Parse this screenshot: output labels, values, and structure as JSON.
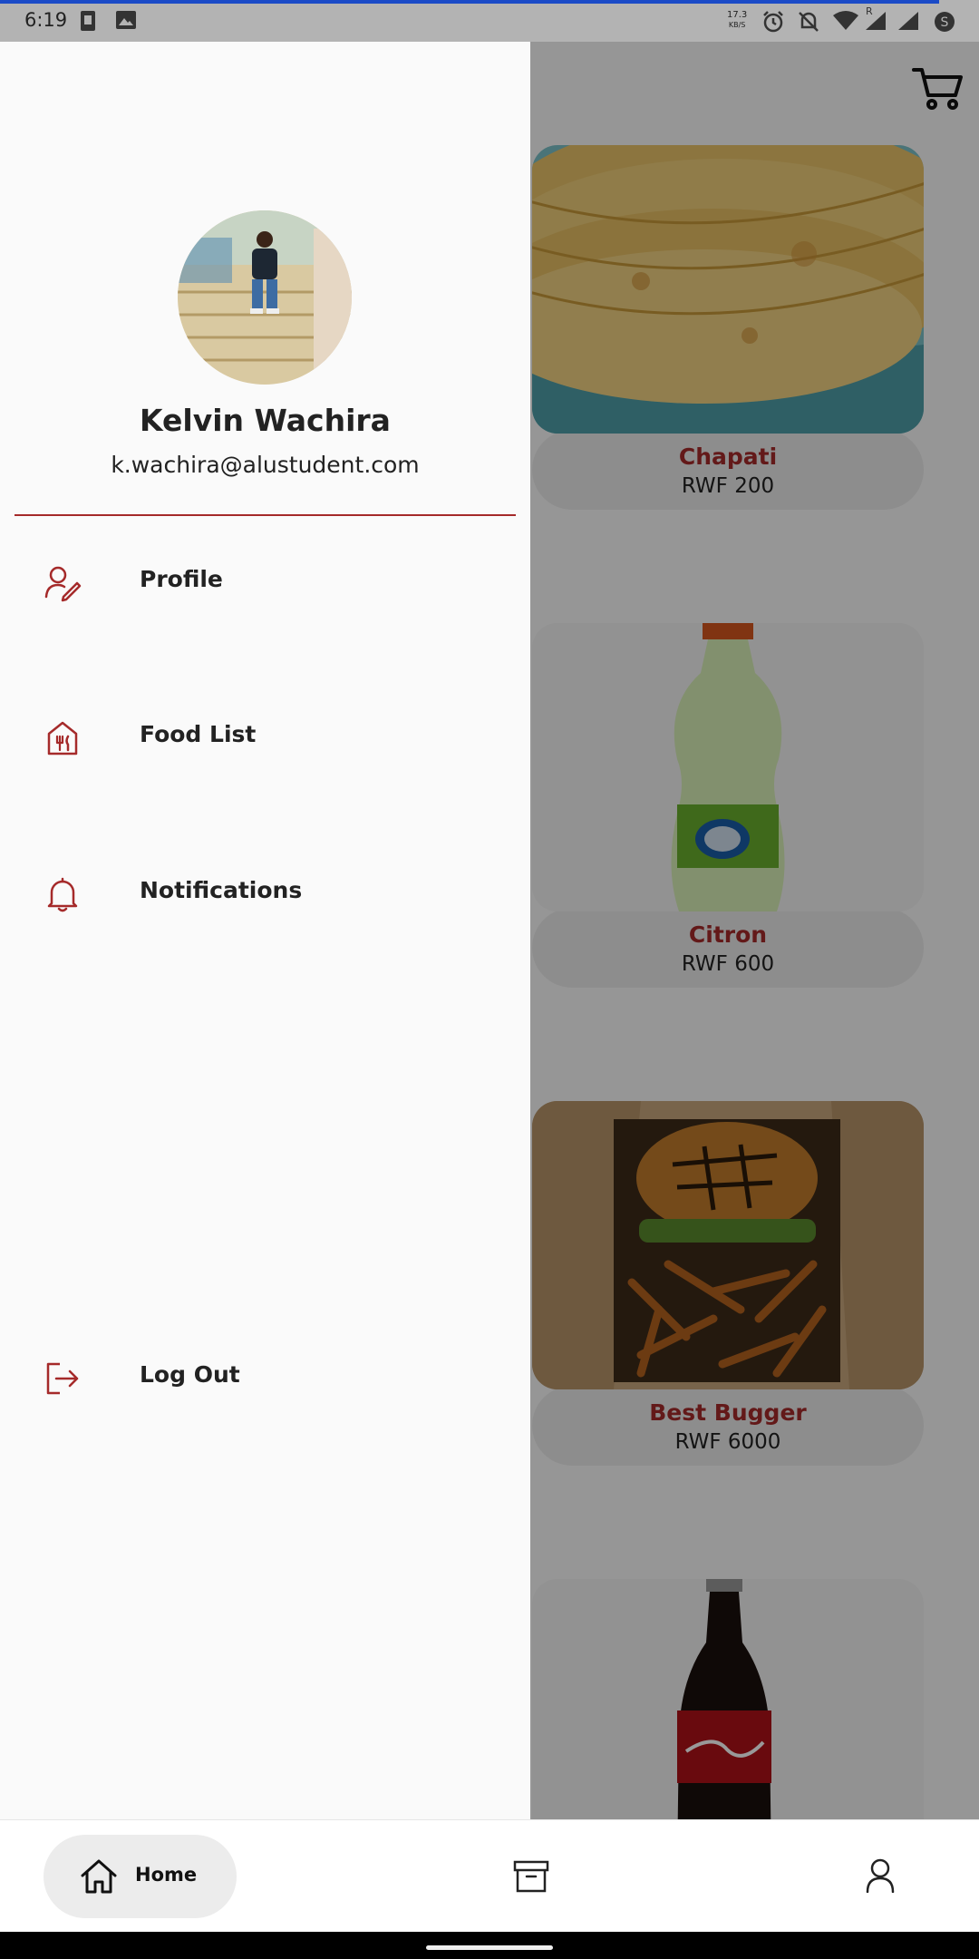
{
  "status_bar": {
    "time": "6:19",
    "net_speed_value": "17.3",
    "net_speed_unit": "KB/S",
    "roaming_mark": "R",
    "icons": [
      "sim-card-icon",
      "image-icon",
      "alarm-icon",
      "silent-icon",
      "wifi-icon",
      "signal-icon",
      "signal-icon",
      "data-saver-icon"
    ]
  },
  "header": {
    "cart_icon": "cart-icon"
  },
  "food_list": [
    {
      "name": "Chapati",
      "price": "RWF 200",
      "image": "chapati-photo"
    },
    {
      "name": "Citron",
      "price": "RWF 600",
      "image": "fanta-citron-bottle-photo"
    },
    {
      "name": "Best Bugger",
      "price": "RWF 6000",
      "image": "burger-fries-photo"
    },
    {
      "name": "",
      "price": "",
      "image": "coca-cola-bottle-photo"
    }
  ],
  "drawer": {
    "user": {
      "name": "Kelvin Wachira",
      "email": "k.wachira@alustudent.com",
      "avatar": "user-avatar-photo"
    },
    "menu": [
      {
        "label": "Profile",
        "icon": "profile-edit-icon"
      },
      {
        "label": "Food List",
        "icon": "restaurant-icon"
      },
      {
        "label": "Notifications",
        "icon": "bell-icon"
      },
      {
        "label": "Log Out",
        "icon": "logout-icon"
      }
    ]
  },
  "bottom_nav": {
    "items": [
      {
        "label": "Home",
        "icon": "home-icon",
        "active": true
      },
      {
        "label": "",
        "icon": "archive-icon",
        "active": false
      },
      {
        "label": "",
        "icon": "person-icon",
        "active": false
      }
    ]
  },
  "colors": {
    "accent": "#a52a2a",
    "drawer_bg": "#fafafa",
    "scrim": "rgba(0,0,0,0.40)",
    "status_bar_bg": "#b3b3b3",
    "progress": "#1b4bc7"
  }
}
